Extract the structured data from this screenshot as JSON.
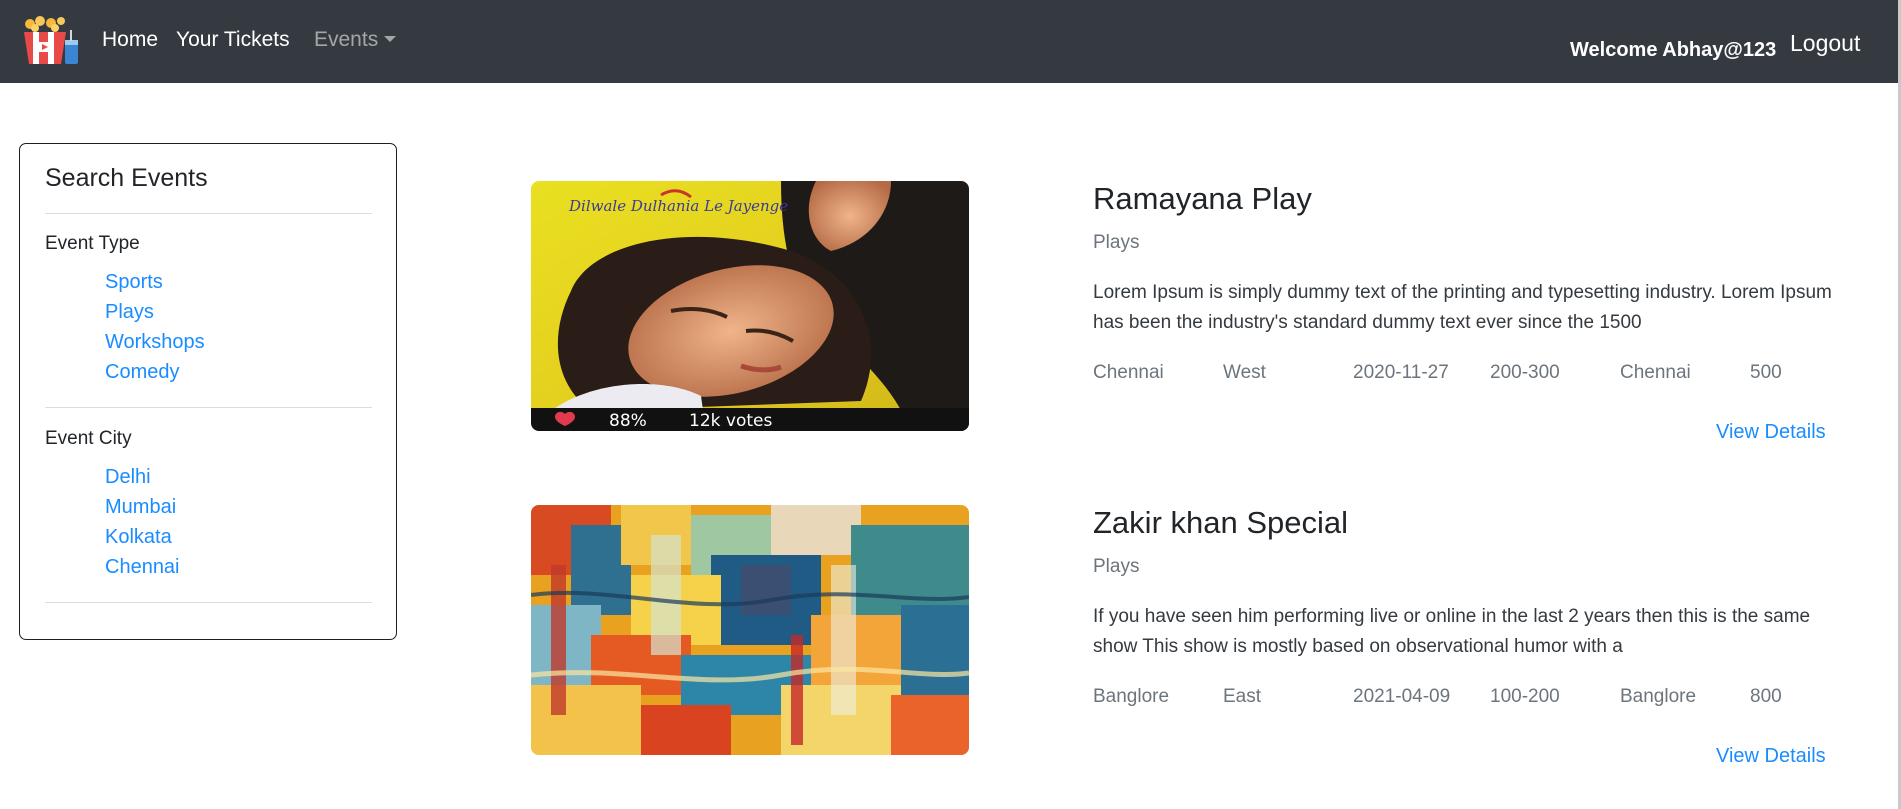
{
  "navbar": {
    "logo_icon": "popcorn-cinema-logo-icon",
    "links": [
      "Home",
      "Your Tickets"
    ],
    "events_dropdown": "Events",
    "welcome": "Welcome Abhay@123",
    "logout": "Logout"
  },
  "sidebar": {
    "title": "Search Events",
    "event_type_label": "Event Type",
    "event_types": [
      "Sports",
      "Plays",
      "Workshops",
      "Comedy"
    ],
    "event_city_label": "Event City",
    "event_cities": [
      "Delhi",
      "Mumbai",
      "Kolkata",
      "Chennai"
    ]
  },
  "events": [
    {
      "title": "Ramayana Play",
      "category": "Plays",
      "description": "Lorem Ipsum is simply dummy text of the printing and typesetting industry. Lorem Ipsum has been the industry's standard dummy text ever since the 1500",
      "city": "Chennai",
      "zone": "West",
      "date": "2020-11-27",
      "price": "200-300",
      "venue": "Chennai",
      "seats": "500",
      "view_details": "View Details",
      "poster": {
        "title_text": "Dilwale Dulhania Le Jayenge",
        "rating": "88%",
        "votes": "12k votes"
      }
    },
    {
      "title": "Zakir khan Special",
      "category": "Plays",
      "description": "If you have seen him performing live or online in the last 2 years then this is the same show This show is mostly based on observational humor with a",
      "city": "Banglore",
      "zone": "East",
      "date": "2021-04-09",
      "price": "100-200",
      "venue": "Banglore",
      "seats": "800",
      "view_details": "View Details"
    }
  ],
  "colors": {
    "navbar_bg": "#343a40",
    "link": "#1a8cff",
    "muted": "#6c757d"
  }
}
